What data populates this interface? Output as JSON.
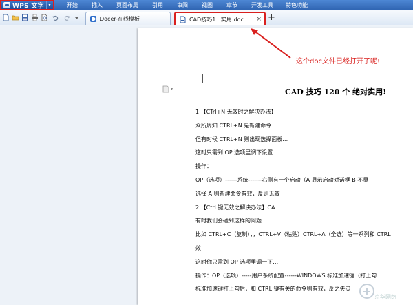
{
  "app": {
    "title": "WPS 文字",
    "menu_arrow": "▾"
  },
  "menu": {
    "items": [
      "开始",
      "插入",
      "页面布局",
      "引用",
      "审阅",
      "视图",
      "章节",
      "开发工具",
      "特色功能"
    ]
  },
  "tabs": [
    {
      "label": "Docer-在线模板",
      "icon": "docer-icon"
    },
    {
      "label": "CAD技巧1...实用.doc",
      "icon": "wps-doc-icon",
      "active": true
    }
  ],
  "tab_close": "×",
  "tab_add": "+",
  "annotation": {
    "text": "这个doc文件已经打开了呢!",
    "color": "#d9201e"
  },
  "document": {
    "page_icon_caret": "▾",
    "title": "CAD 技巧 120 个 绝对实用!",
    "lines": [
      "1.【CTrl+N 无效时之解决办法】",
      "众所周知 CTRL+N 是新建命令",
      "但有时候 CTRL+N 则出现选择面板…",
      "这时只需到 OP 选项里调下设置",
      "操作：",
      "OP（选项）------系统-------右侧有一个启动（A 显示启动对话框 B 不显",
      "选择 A 则新建命令有效，反则无效",
      "2.【Ctrl 键无效之解决办法】CA",
      "有时我们会碰到这样的问题……",
      "比如 CTRL+C（复制），，CTRL+V（粘贴）CTRL+A（全选）等一系列和 CTRL",
      "效",
      "这时你只需到 OP 选项里调一下…",
      "操作：OP（选项）-----用户系统配置------WINDOWS 标准加速键（打上勾",
      "标准加速键打上勾后，和 CTRL 键有关的命令则有效，反之失灵"
    ]
  },
  "watermark": {
    "text": "京华网络"
  },
  "colors": {
    "accent_red": "#d9201e",
    "menubar_blue": "#2e63b0"
  }
}
